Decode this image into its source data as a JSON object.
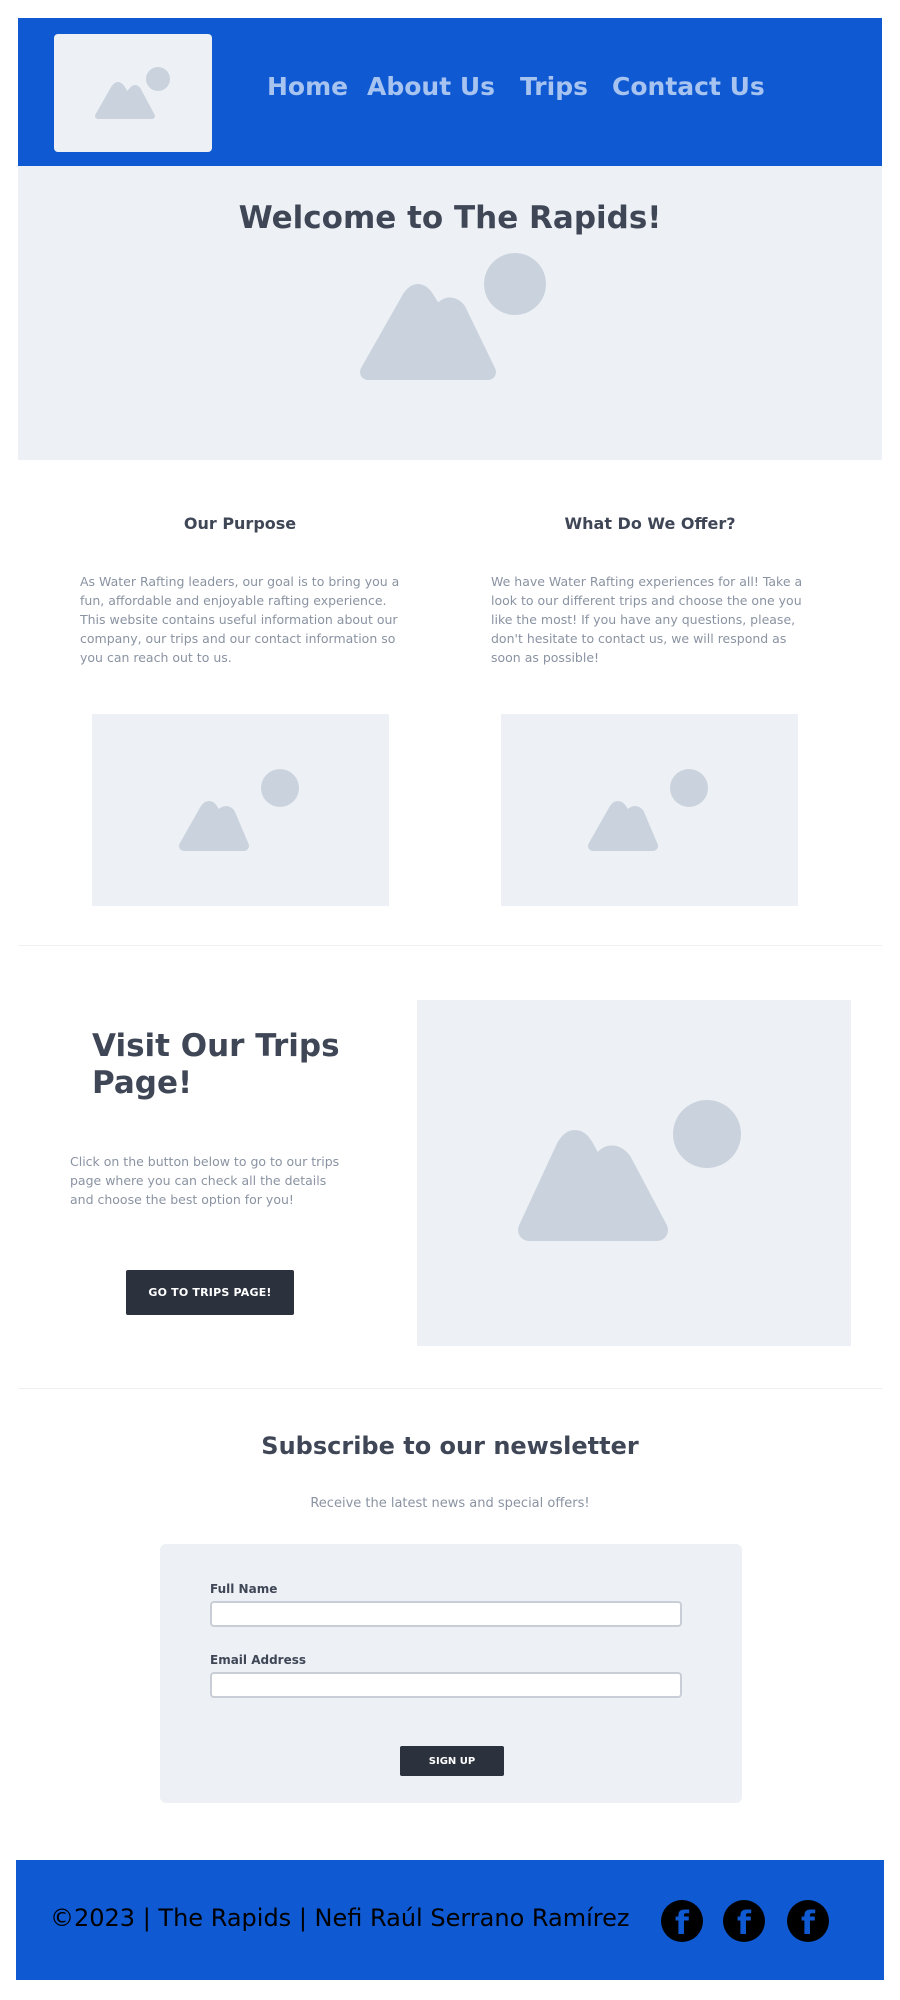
{
  "header": {
    "logo_icon": "image-placeholder-icon",
    "nav": [
      {
        "label": "Home"
      },
      {
        "label": "About Us"
      },
      {
        "label": "Trips"
      },
      {
        "label": "Contact Us"
      }
    ]
  },
  "hero": {
    "title": "Welcome to The Rapids!",
    "image_icon": "image-placeholder-icon"
  },
  "purpose": {
    "title": "Our Purpose",
    "text": "As Water Rafting leaders, our goal is to bring you a fun, affordable and enjoyable rafting experience. This website contains useful information about our company, our trips and our contact information so you can reach out to us."
  },
  "offer": {
    "title": "What Do We Offer?",
    "text": "We have Water Rafting experiences for all! Take a look to our different trips and choose the one you like the most! If you have any questions, please, don't hesitate to contact us, we will respond as soon as possible!"
  },
  "trips": {
    "title": "Visit Our Trips Page!",
    "text": "Click on the button below to go to our trips page where you can check all the details and choose the best option for you!",
    "button": "Go to trips page!"
  },
  "newsletter": {
    "title": "Subscribe to our newsletter",
    "subtitle": "Receive the latest news and special offers!",
    "full_name_label": "Full Name",
    "full_name_value": "",
    "email_label": "Email Address",
    "email_value": "",
    "button": "Sign up"
  },
  "footer": {
    "copyright": "©2023 | The Rapids | Nefi Raúl Serrano Ramírez",
    "social_icons": [
      "facebook-icon",
      "facebook-icon",
      "facebook-icon"
    ]
  },
  "colors": {
    "brand_blue": "#0f59d3",
    "nav_text": "#a7c3ef",
    "placeholder_bg": "#edf1f5",
    "placeholder_shape": "#cad3dd",
    "dark_button": "#2b313d",
    "heading": "#3f4656",
    "body_text": "#8a93a2"
  }
}
